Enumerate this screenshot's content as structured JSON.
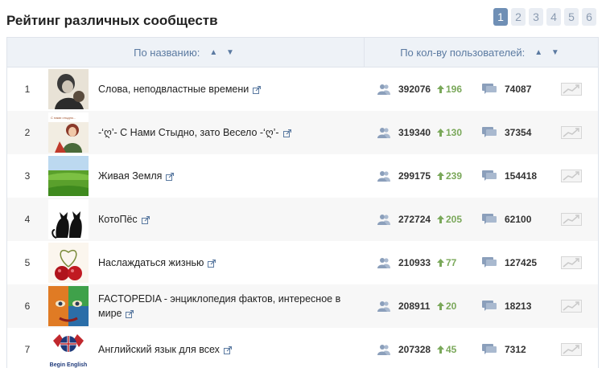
{
  "page_title": "Рейтинг различных сообществ",
  "pagination": {
    "pages": [
      "1",
      "2",
      "3",
      "4",
      "5",
      "6"
    ],
    "active": "1"
  },
  "table": {
    "headers": {
      "by_name": "По названию:",
      "by_users": "По кол-ву пользователей:",
      "sort_arrows": "▲ ▼"
    },
    "rows": [
      {
        "rank": "1",
        "name": "Слова, неподвластные времени",
        "name_line2": "",
        "users": "392076",
        "growth": "196",
        "posts": "74087",
        "thumb": "portrait-bw"
      },
      {
        "rank": "2",
        "name": "-‘ღ’- С Нами Стыдно, зато Весело -‘ღ’-",
        "name_line2": "",
        "users": "319340",
        "growth": "130",
        "posts": "37354",
        "thumb": "girl-illustration"
      },
      {
        "rank": "3",
        "name": "Живая Земля",
        "name_line2": "",
        "users": "299175",
        "growth": "239",
        "posts": "154418",
        "thumb": "green-field"
      },
      {
        "rank": "4",
        "name": "КотоПёс",
        "name_line2": "",
        "users": "272724",
        "growth": "205",
        "posts": "62100",
        "thumb": "cat-dog-silhouette"
      },
      {
        "rank": "5",
        "name": "Наслаждаться жизнью",
        "name_line2": "",
        "users": "210933",
        "growth": "77",
        "posts": "127425",
        "thumb": "cherries-heart"
      },
      {
        "rank": "6",
        "name": "FACTOPEDIA - энциклопедия фактов, интересное в",
        "name_line2": "мире",
        "users": "208911",
        "growth": "20",
        "posts": "18213",
        "thumb": "painted-face"
      },
      {
        "rank": "7",
        "name": "Английский язык для всех",
        "name_line2": "",
        "users": "207328",
        "growth": "45",
        "posts": "7312",
        "thumb": "begin-english-logo",
        "thumb_text": "Begin English"
      }
    ]
  },
  "colors": {
    "accent": "#6f8fb5",
    "header_text": "#5b7aa1",
    "growth": "#7aa85a"
  }
}
